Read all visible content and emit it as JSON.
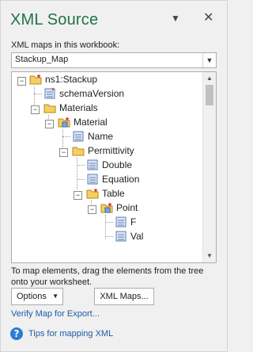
{
  "pane": {
    "title": "XML Source",
    "options_icon": "chevron-down-icon",
    "close_icon": "close-icon"
  },
  "maps": {
    "label": "XML maps in this workbook:",
    "selected": "Stackup_Map"
  },
  "tree": {
    "nodes": [
      {
        "label": "ns1:Stackup",
        "icon": "root-element-icon",
        "expanded": true
      },
      {
        "label": "schemaVersion",
        "icon": "attribute-icon"
      },
      {
        "label": "Materials",
        "icon": "folder-icon",
        "expanded": true
      },
      {
        "label": "Material",
        "icon": "repeating-element-icon",
        "expanded": true
      },
      {
        "label": "Name",
        "icon": "field-icon"
      },
      {
        "label": "Permittivity",
        "icon": "folder-icon",
        "expanded": true
      },
      {
        "label": "Double",
        "icon": "field-icon"
      },
      {
        "label": "Equation",
        "icon": "field-icon"
      },
      {
        "label": "Table",
        "icon": "folder-icon",
        "expanded": true
      },
      {
        "label": "Point",
        "icon": "repeating-element-icon",
        "expanded": true
      },
      {
        "label": "F",
        "icon": "field-icon"
      },
      {
        "label": "Val",
        "icon": "field-icon"
      }
    ]
  },
  "hint": "To map elements, drag the elements from the tree onto your worksheet.",
  "buttons": {
    "options": "Options",
    "xml_maps": "XML Maps..."
  },
  "links": {
    "verify": "Verify Map for Export...",
    "tips": "Tips for mapping XML"
  },
  "colors": {
    "title": "#217346",
    "link": "#1e5aa8"
  }
}
